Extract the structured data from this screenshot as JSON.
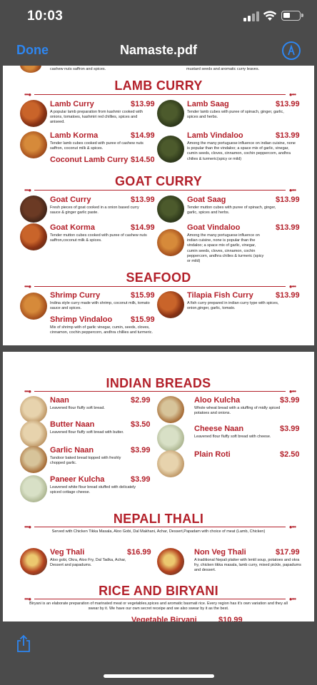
{
  "status": {
    "time": "10:03"
  },
  "nav": {
    "done": "Done",
    "title": "Namaste.pdf",
    "markup_icon": "markup-pen-icon"
  },
  "page1": {
    "top_cut_left": "cashew nuts saffron and spices.",
    "top_cut_right": "mustard seeds and aromatic curry leaves.",
    "lamb_title": "LAMB CURRY",
    "lamb": [
      {
        "name": "Lamb Curry",
        "price": "$13.99",
        "desc": "A popular lamb preparation from kashmir cooked with onions, tomatoes, kashmiri red chillies, spices and aniseed."
      },
      {
        "name": "Lamb Saag",
        "price": "$13.99",
        "desc": "Tender lamb cubes with puree of spinach, ginger, garlic, spices and herbs."
      },
      {
        "name": "Lamb Korma",
        "price": "$14.99",
        "desc": "Tender lamb cubes cooked with puree of cashew nuts saffron, coconut milk & spices."
      },
      {
        "name": "Lamb Vindaloo",
        "price": "$13.99",
        "desc": "Among the many portuguese influence on indian cuisine, none is popular than the vindaloo; a space mix of garlic, vinegar, cumin seeds, cloves, cinnamon, cochin peppercorn, andhra chilies & turmeric(spicy or mild)"
      },
      {
        "name": "Coconut Lamb Curry",
        "price": "$14.50",
        "desc": ""
      }
    ],
    "goat_title": "GOAT CURRY",
    "goat": [
      {
        "name": "Goat Curry",
        "price": "$13.99",
        "desc": "Fresh pieces of goat cooked in a onion based curry sauce & ginger garlic paste."
      },
      {
        "name": "Goat Saag",
        "price": "$13.99",
        "desc": "Tender mutton cubes with puree of spinach, ginger, garlic, spices and herbs."
      },
      {
        "name": "Goat Korma",
        "price": "$14.99",
        "desc": "Tender mutton cubes cooked with puree of cashew nuts saffron,coconut milk & spices."
      },
      {
        "name": "Goat Vindaloo",
        "price": "$13.99",
        "desc": "Among the many portuguese influence on indian cuisine, none is popular than the vindaloo; a space mix of garlic, vinegar, cumin seeds, cloves, cinnamon, cochin peppercorn, andhra chilies & turmeric (spicy or mild)"
      }
    ],
    "sea_title": "SEAFOOD",
    "sea": [
      {
        "name": "Shrimp Curry",
        "price": "$15.99",
        "desc": "Indina style curry made with shrimp, coconut milk, tomato sauce and spices."
      },
      {
        "name": "Tilapia Fish Curry",
        "price": "$13.99",
        "desc": "A fish curry prepared in indian curry type with spices, onion,ginger, garlic, tomato."
      },
      {
        "name": "Shrimp Vindaloo",
        "price": "$15.99",
        "desc": "Mix of shrimp with of garlic vinegar, cumin, seeds, cloves, cinnamon, cochin peppercorn, andhra chillies and turmeric."
      }
    ]
  },
  "page2": {
    "breads_title": "INDIAN BREADS",
    "breads": [
      {
        "name": "Naan",
        "price": "$2.99",
        "desc": "Leavened flour fluffy soft bread."
      },
      {
        "name": "Aloo Kulcha",
        "price": "$3.99",
        "desc": "Whole wheat bread with a stuffing of midly spiced potatoes and onions."
      },
      {
        "name": "Butter Naan",
        "price": "$3.50",
        "desc": "Leavened flour fluffy soft bread with butter."
      },
      {
        "name": "Cheese Naan",
        "price": "$3.99",
        "desc": "Leavened flour fluffy soft bread with cheese."
      },
      {
        "name": "Garlic Naan",
        "price": "$3.99",
        "desc": "Tandoor baked bread topped with freshly chopped garlic."
      },
      {
        "name": "Plain Roti",
        "price": "$2.50",
        "desc": ""
      },
      {
        "name": "Paneer Kulcha",
        "price": "$3.99",
        "desc": "Leavened white flour bread stuffed with delicately spiced cottage cheese."
      }
    ],
    "thali_title": "NEPALI THALI",
    "thali_note": "Served with Chicken Tikka Masala, Aloo Gobi, Dal Makhani, Achar, Dessert,Papadam with choice of meat (Lamb, Chicken)",
    "thali": [
      {
        "name": "Veg Thali",
        "price": "$16.99",
        "desc": "Aloo gobi, Okra, Aloo Fry, Dal Tadka, Achar, Dessert and papadums."
      },
      {
        "name": "Non Veg Thali",
        "price": "$17.99",
        "desc": "A traditional Nepali platter with lentil soup, potatoes and okra fry, chicken tikka masala, lamb curry, mixed pickle, papadums and dessert."
      }
    ],
    "rice_title": "RICE AND BIRYANI",
    "rice_note": "Biryani is an elaborate preparation of marinated meat or vegetables,spices and aromatic basmati rice. Every region has it's own variation and they all swear by it. We have our own secret receipe and we also swear by it as the best.",
    "rice_cut": "Vegetable Biryani",
    "rice_cut_price": "$10.99"
  },
  "bottom": {
    "share_icon": "share-icon"
  }
}
